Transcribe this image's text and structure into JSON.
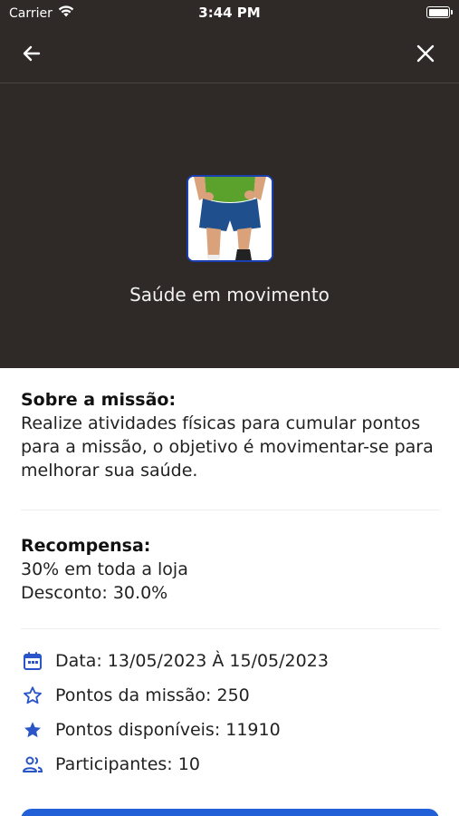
{
  "status_bar": {
    "carrier": "Carrier",
    "time": "3:44 PM"
  },
  "nav": {
    "back_icon": "arrow-left-icon",
    "close_icon": "close-icon"
  },
  "mission": {
    "title": "Saúde em movimento"
  },
  "about": {
    "heading": "Sobre a missão:",
    "text": "Realize atividades físicas para cumular pontos para a missão, o objetivo é movimentar-se para melhorar sua saúde."
  },
  "reward": {
    "heading": "Recompensa:",
    "line1": "30% em toda a loja",
    "line2": "Desconto: 30.0%"
  },
  "details": [
    {
      "icon": "calendar-icon",
      "text": "Data: 13/05/2023 À 15/05/2023"
    },
    {
      "icon": "star-outline-icon",
      "text": "Pontos da missão: 250"
    },
    {
      "icon": "star-filled-icon",
      "text": "Pontos disponíveis: 11910"
    },
    {
      "icon": "people-icon",
      "text": "Participantes: 10"
    }
  ],
  "colors": {
    "hero_bg": "#2f2a28",
    "accent": "#2260d8"
  }
}
